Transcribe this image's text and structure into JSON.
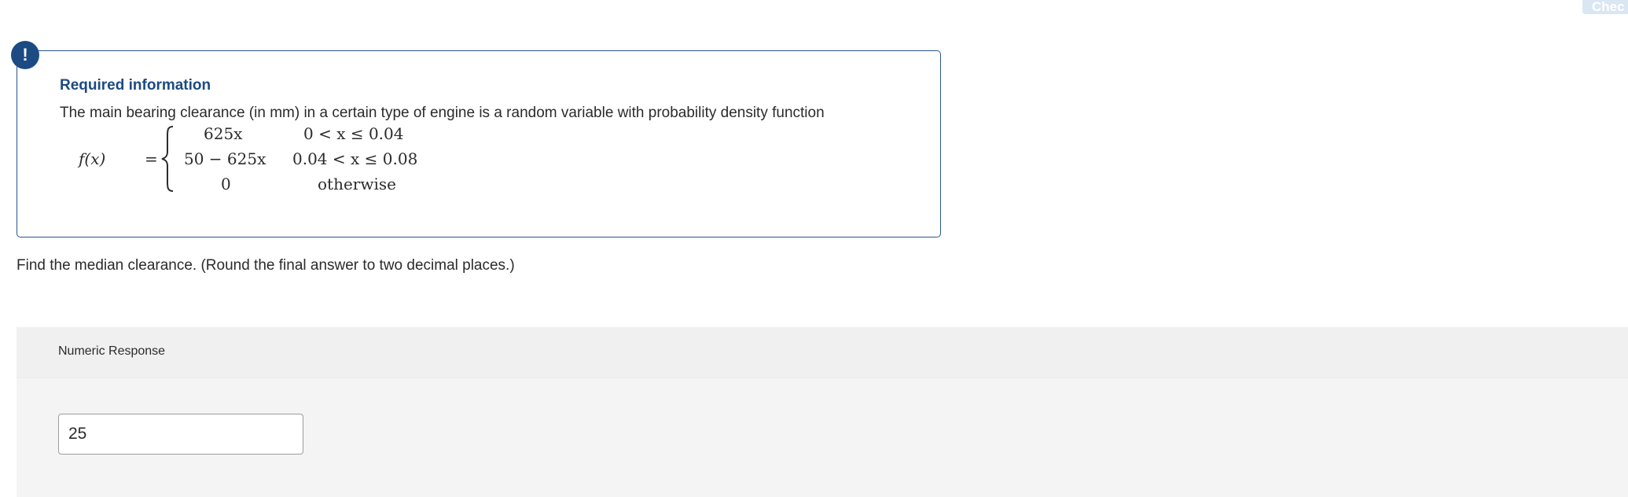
{
  "header": {
    "check_label": "Chec"
  },
  "info": {
    "badge": "!",
    "title": "Required information",
    "text": "The main bearing clearance (in mm) in a certain type of engine is a random variable with probability density function"
  },
  "formula": {
    "lhs": "f(x)",
    "equals": "=",
    "cases": [
      {
        "expr": "625x",
        "condition": "0 < x ≤ 0.04"
      },
      {
        "expr": "50 − 625x",
        "condition": "0.04 < x ≤ 0.08"
      },
      {
        "expr": "0",
        "condition": "otherwise"
      }
    ]
  },
  "question": {
    "text": "Find the median clearance. (Round the final answer to two decimal places.)"
  },
  "response": {
    "label": "Numeric Response",
    "value": "25"
  }
}
